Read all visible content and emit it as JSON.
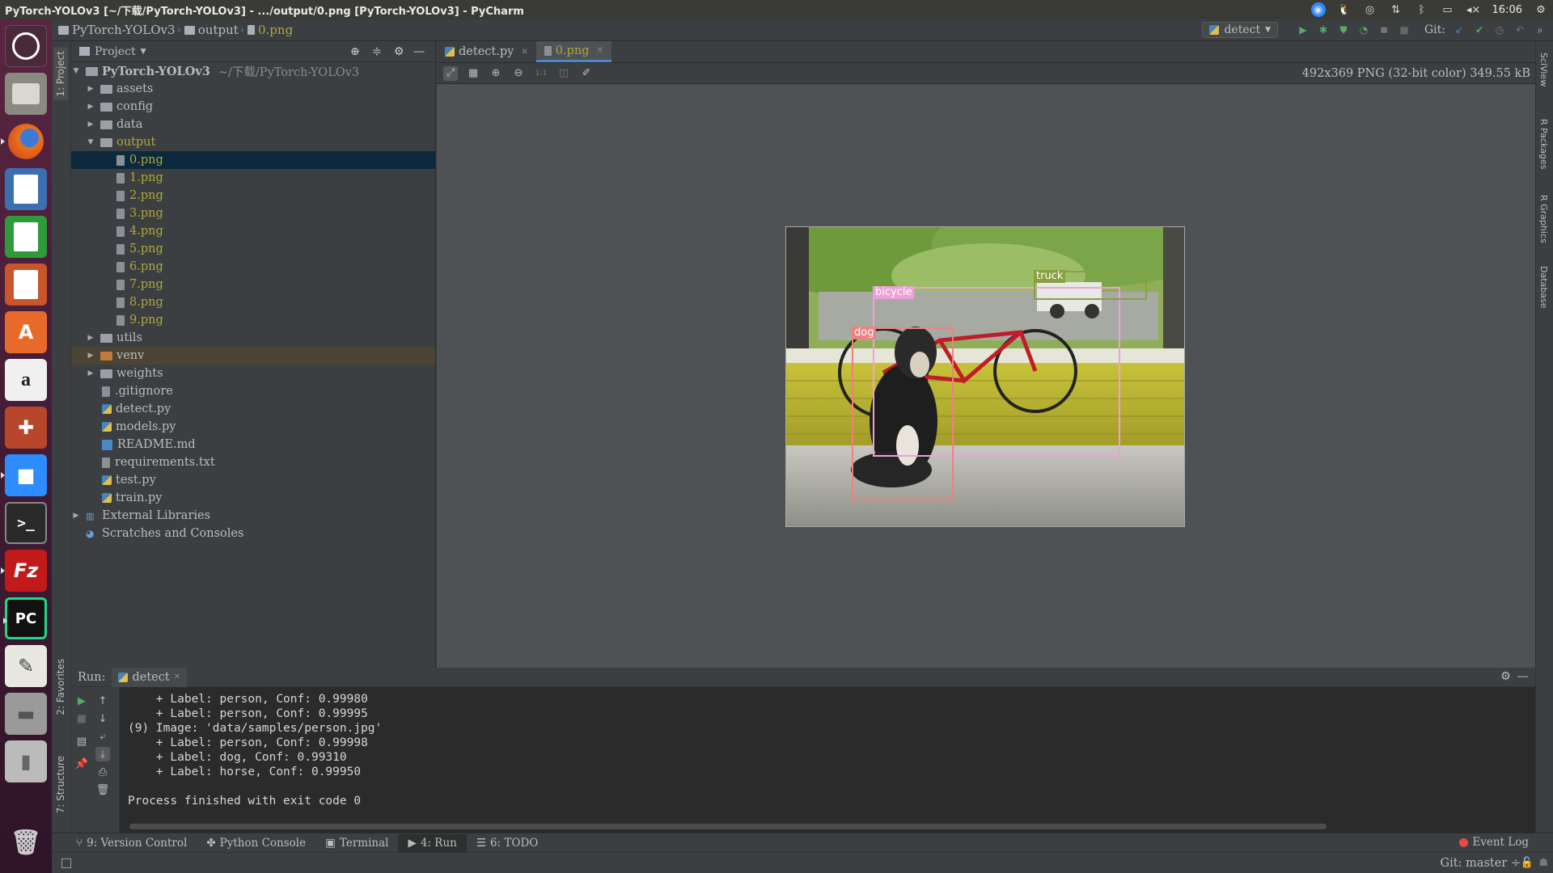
{
  "window": {
    "title": "PyTorch-YOLOv3 [~/下载/PyTorch-YOLOv3] - .../output/0.png [PyTorch-YOLOv3] - PyCharm",
    "clock": "16:06"
  },
  "navbar": {
    "crumbs": [
      "PyTorch-YOLOv3",
      "output",
      "0.png"
    ],
    "run_config": "detect",
    "git_label": "Git:"
  },
  "left_tabs": {
    "project": "1: Project",
    "favorites": "2: Favorites",
    "structure": "7: Structure"
  },
  "right_tabs": [
    "SciView",
    "R Packages",
    "R Graphics",
    "Database"
  ],
  "project": {
    "header": "Project",
    "root_name": "PyTorch-YOLOv3",
    "root_path": "~/下载/PyTorch-YOLOv3",
    "folders_top": [
      "assets",
      "config",
      "data"
    ],
    "output_folder": "output",
    "output_files": [
      "0.png",
      "1.png",
      "2.png",
      "3.png",
      "4.png",
      "5.png",
      "6.png",
      "7.png",
      "8.png",
      "9.png"
    ],
    "folders_mid": [
      "utils",
      "venv",
      "weights"
    ],
    "files": [
      ".gitignore",
      "detect.py",
      "models.py",
      "README.md",
      "requirements.txt",
      "test.py",
      "train.py"
    ],
    "external": "External Libraries",
    "scratches": "Scratches and Consoles"
  },
  "editor": {
    "tabs": [
      "detect.py",
      "0.png"
    ],
    "image_info": "492x369 PNG (32-bit color) 349.55 kB",
    "detections": [
      {
        "label": "bicycle",
        "color": "#f0a0d8"
      },
      {
        "label": "truck",
        "color": "#8aa040"
      },
      {
        "label": "dog",
        "color": "#f08080"
      }
    ]
  },
  "run": {
    "label": "Run:",
    "tab": "detect",
    "lines": [
      "    + Label: person, Conf: 0.99980",
      "    + Label: person, Conf: 0.99995",
      "(9) Image: 'data/samples/person.jpg'",
      "    + Label: person, Conf: 0.99998",
      "    + Label: dog, Conf: 0.99310",
      "    + Label: horse, Conf: 0.99950",
      "",
      "Process finished with exit code 0"
    ]
  },
  "bottom_tabs": [
    "9: Version Control",
    "Python Console",
    "Terminal",
    "4: Run",
    "6: TODO"
  ],
  "event_log": "Event Log",
  "status": {
    "git_branch": "Git: master ÷"
  }
}
